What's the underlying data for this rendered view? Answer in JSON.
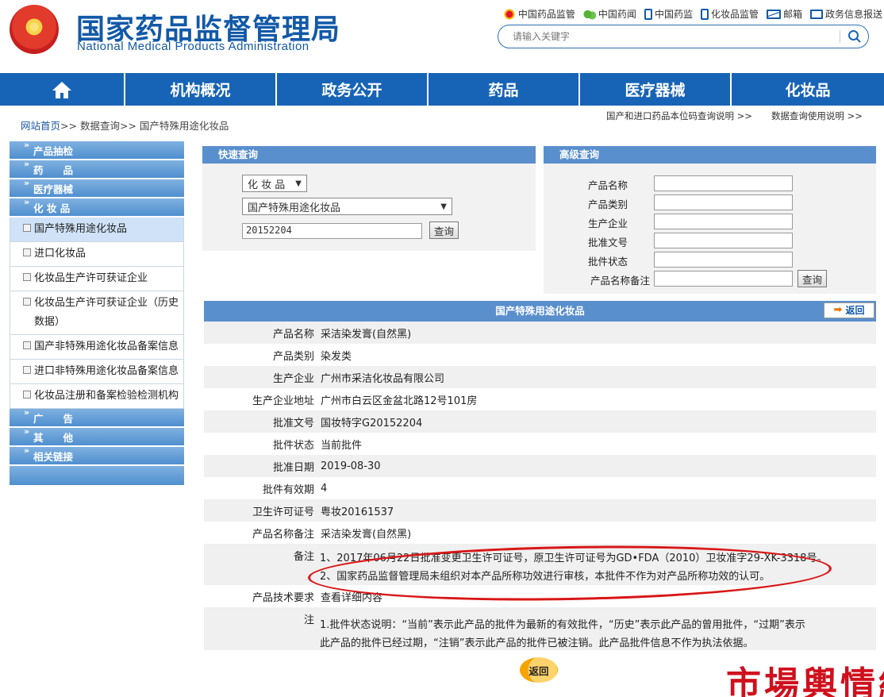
{
  "header": {
    "org_cn": "国家药品监督管理局",
    "org_en": "National Medical Products Administration",
    "links": [
      "中国药品监管",
      "中国药闻",
      "中国药监",
      "化妆品监管",
      "邮箱",
      "政务信息报送"
    ],
    "search_placeholder": "请输入关键字"
  },
  "nav": {
    "items": [
      "机构概况",
      "政务公开",
      "药品",
      "医疗器械",
      "化妆品"
    ]
  },
  "breadcrumb": {
    "home": "网站首页",
    "sep": ">>",
    "query": "数据查询",
    "current": "国产特殊用途化妆品"
  },
  "right_links": [
    "国产和进口药品本位码查询说明 >>",
    "数据查询使用说明 >>"
  ],
  "sidebar": {
    "headers": [
      "产品抽检",
      "药　　品",
      "医疗器械",
      "化 妆 品",
      "广　　告",
      "其　　他",
      "相关链接"
    ],
    "items": [
      "国产特殊用途化妆品",
      "进口化妆品",
      "化妆品生产许可获证企业",
      "化妆品生产许可获证企业（历史数据）",
      "国产非特殊用途化妆品备案信息",
      "进口非特殊用途化妆品备案信息",
      "化妆品注册和备案检验检测机构"
    ]
  },
  "quick": {
    "title": "快速查询",
    "category": "化 妆 品",
    "subcategory": "国产特殊用途化妆品",
    "keyword": "20152204",
    "btn": "查询"
  },
  "advanced": {
    "title": "高级查询",
    "fields": [
      "产品名称",
      "产品类别",
      "生产企业",
      "批准文号",
      "批件状态",
      "产品名称备注"
    ],
    "btn": "查询"
  },
  "detail": {
    "title": "国产特殊用途化妆品",
    "back": "返回",
    "rows": [
      {
        "k": "产品名称",
        "v": "采洁染发膏(自然黑)"
      },
      {
        "k": "产品类别",
        "v": "染发类"
      },
      {
        "k": "生产企业",
        "v": "广州市采洁化妆品有限公司"
      },
      {
        "k": "生产企业地址",
        "v": "广州市白云区金盆北路12号101房"
      },
      {
        "k": "批准文号",
        "v": "国妆特字G20152204"
      },
      {
        "k": "批件状态",
        "v": "当前批件"
      },
      {
        "k": "批准日期",
        "v": "2019-08-30"
      },
      {
        "k": "批件有效期",
        "v": "4"
      },
      {
        "k": "卫生许可证号",
        "v": "粤妆20161537"
      },
      {
        "k": "产品名称备注",
        "v": "采洁染发膏(自然黑)"
      }
    ],
    "remark_label": "备注",
    "remark1": "1、2017年06月22日批准变更卫生许可证号，原卫生许可证号为GD•FDA（2010）卫妆准字29-XK-3318号。",
    "remark2": "2、国家药品监督管理局未组织对本产品所称功效进行审核，本批件不作为对产品所称功效的认可。",
    "tech_label": "产品技术要求",
    "tech_value": "查看详细内容",
    "note_label": "注",
    "note1": "1.批件状态说明：“当前”表示此产品的批件为最新的有效批件，“历史”表示此产品的曾用批件，“过期”表示",
    "note2": "此产品的批件已经过期，“注销”表示此产品的批件已被注销。此产品批件信息不作为执法依据。"
  },
  "footer_back": "返回",
  "watermark": "市場輿情網",
  "colors": {
    "brand": "#1764b6",
    "panel": "#5a8fcd",
    "circle": "#d91616"
  }
}
